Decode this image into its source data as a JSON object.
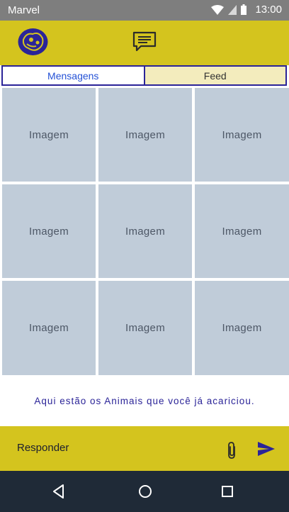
{
  "status_bar": {
    "carrier": "Marvel",
    "time": "13:00"
  },
  "tabs": [
    {
      "label": "Mensagens",
      "active": true
    },
    {
      "label": "Feed",
      "active": false
    }
  ],
  "grid": [
    "Imagem",
    "Imagem",
    "Imagem",
    "Imagem",
    "Imagem",
    "Imagem",
    "Imagem",
    "Imagem",
    "Imagem"
  ],
  "caption": "Aqui estão os Animais que você já acariciou.",
  "reply": {
    "label": "Responder"
  },
  "colors": {
    "accent": "#d4c41e",
    "brand_blue": "#2b2498",
    "tile": "#c0ccd9",
    "nav": "#1f2a37"
  },
  "icons": [
    "wifi-icon",
    "signal-icon",
    "battery-icon",
    "logo-icon",
    "chat-icon",
    "attach-icon",
    "send-icon",
    "back-icon",
    "home-icon",
    "recents-icon"
  ]
}
